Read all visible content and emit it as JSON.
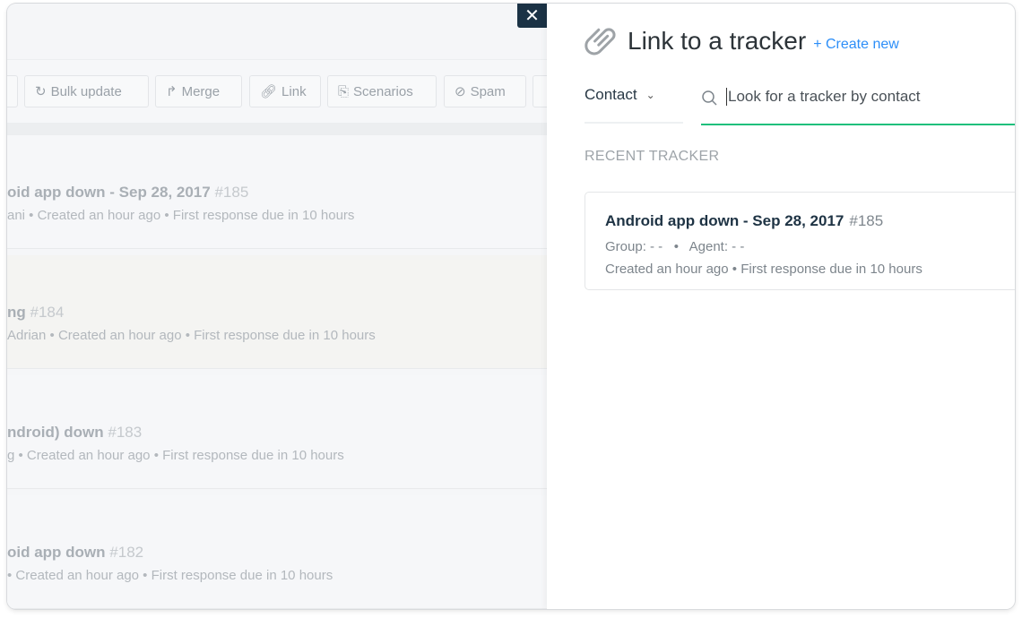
{
  "background": {
    "toolbar": [
      {
        "icon": "refresh-icon",
        "label": "Bulk update"
      },
      {
        "icon": "merge-icon",
        "label": "Merge"
      },
      {
        "icon": "link-icon",
        "label": "Link"
      },
      {
        "icon": "scenarios-icon",
        "label": "Scenarios"
      },
      {
        "icon": "spam-icon",
        "label": "Spam"
      }
    ],
    "tickets": [
      {
        "title": "oid app down - Sep 28, 2017",
        "number": "#185",
        "meta": "ani  •  Created an hour ago  •  First response due in 10 hours"
      },
      {
        "title": "ng",
        "number": "#184",
        "meta": "Adrian  •  Created an hour ago  •  First response due in 10 hours"
      },
      {
        "title": "ndroid) down",
        "number": "#183",
        "meta": "g  •  Created an hour ago  •  First response due in 10 hours"
      },
      {
        "title": "oid app down",
        "number": "#182",
        "meta": "  •  Created an hour ago  •  First response due in 10 hours"
      }
    ]
  },
  "close_label": "✕",
  "panel": {
    "title": "Link to a tracker",
    "create_new": "+ Create new",
    "filter": "Contact",
    "search_placeholder": "Look for a tracker by contact",
    "section": "RECENT TRACKER",
    "tracker": {
      "title": "Android app down - Sep 28, 2017",
      "number": "#185",
      "group": "Group: - -",
      "agent": "Agent: - -",
      "created": "Created an hour ago",
      "due": "First response due in 10 hours"
    }
  },
  "colors": {
    "accent": "#1fbf7c",
    "link": "#2c8ef8",
    "close_bg": "#1b3245"
  }
}
